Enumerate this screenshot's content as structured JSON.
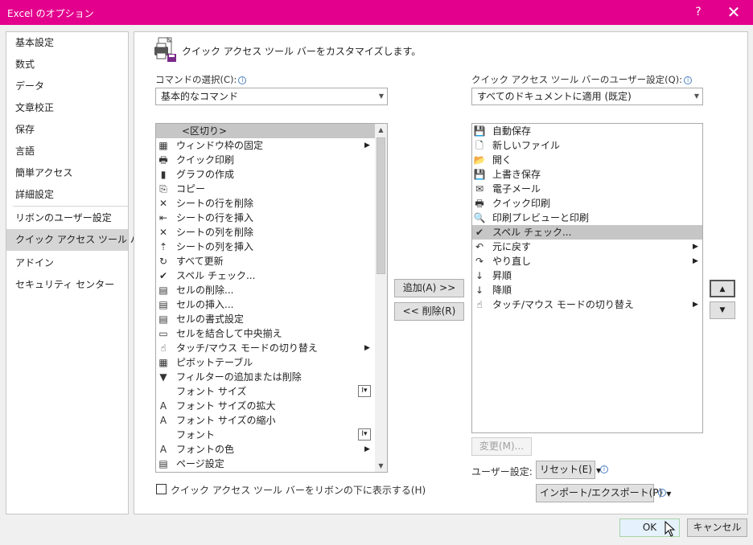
{
  "window": {
    "title": "Excel のオプション",
    "help": "?",
    "close": "✕"
  },
  "sidebar": {
    "items": [
      {
        "label": "基本設定"
      },
      {
        "label": "数式"
      },
      {
        "label": "データ"
      },
      {
        "label": "文章校正"
      },
      {
        "label": "保存"
      },
      {
        "label": "言語"
      },
      {
        "label": "簡単アクセス"
      },
      {
        "label": "詳細設定"
      },
      {
        "label": "リボンのユーザー設定"
      },
      {
        "label": "クイック アクセス ツール バー",
        "selected": true
      },
      {
        "label": "アドイン"
      },
      {
        "label": "セキュリティ センター"
      }
    ]
  },
  "header": {
    "title": "クイック アクセス ツール バーをカスタマイズします。"
  },
  "left": {
    "label": "コマンドの選択(C):",
    "combo": "基本的なコマンド",
    "items": [
      {
        "label": "<区切り>",
        "icon": "",
        "selected": true
      },
      {
        "label": "ウィンドウ枠の固定",
        "icon": "▦",
        "submenu": true
      },
      {
        "label": "クイック印刷",
        "icon": "🖶"
      },
      {
        "label": "グラフの作成",
        "icon": "▮"
      },
      {
        "label": "コピー",
        "icon": "⎘"
      },
      {
        "label": "シートの行を削除",
        "icon": "✕"
      },
      {
        "label": "シートの行を挿入",
        "icon": "⇤"
      },
      {
        "label": "シートの列を削除",
        "icon": "✕"
      },
      {
        "label": "シートの列を挿入",
        "icon": "⇡"
      },
      {
        "label": "すべて更新",
        "icon": "↻"
      },
      {
        "label": "スペル チェック...",
        "icon": "✔"
      },
      {
        "label": "セルの削除...",
        "icon": "▤"
      },
      {
        "label": "セルの挿入...",
        "icon": "▤"
      },
      {
        "label": "セルの書式設定",
        "icon": "▤"
      },
      {
        "label": "セルを結合して中央揃え",
        "icon": "▭"
      },
      {
        "label": "タッチ/マウス モードの切り替え",
        "icon": "☝",
        "submenu": true
      },
      {
        "label": "ピボットテーブル",
        "icon": "▦"
      },
      {
        "label": "フィルターの追加または削除",
        "icon": "▼"
      },
      {
        "label": "フォント サイズ",
        "icon": "",
        "fieldbox": "I▾"
      },
      {
        "label": "フォント サイズの拡大",
        "icon": "A"
      },
      {
        "label": "フォント サイズの縮小",
        "icon": "A"
      },
      {
        "label": "フォント",
        "icon": "",
        "fieldbox": "I▾"
      },
      {
        "label": "フォントの色",
        "icon": "A",
        "submenu": true
      },
      {
        "label": "ページ設定",
        "icon": "▤"
      }
    ]
  },
  "right": {
    "label": "クイック アクセス ツール バーのユーザー設定(Q):",
    "combo": "すべてのドキュメントに適用 (既定)",
    "items": [
      {
        "label": "自動保存",
        "icon": "💾"
      },
      {
        "label": "新しいファイル",
        "icon": "🗋"
      },
      {
        "label": "開く",
        "icon": "📂"
      },
      {
        "label": "上書き保存",
        "icon": "💾"
      },
      {
        "label": "電子メール",
        "icon": "✉"
      },
      {
        "label": "クイック印刷",
        "icon": "🖶"
      },
      {
        "label": "印刷プレビューと印刷",
        "icon": "🔍"
      },
      {
        "label": "スペル チェック...",
        "icon": "✔",
        "selected": true
      },
      {
        "label": "元に戻す",
        "icon": "↶",
        "submenu": true
      },
      {
        "label": "やり直し",
        "icon": "↷",
        "submenu": true
      },
      {
        "label": "昇順",
        "icon": "↓"
      },
      {
        "label": "降順",
        "icon": "↓"
      },
      {
        "label": "タッチ/マウス モードの切り替え",
        "icon": "☝",
        "submenu": true
      }
    ]
  },
  "buttons": {
    "add": "追加(A) >>",
    "remove": "<< 削除(R)",
    "modify": "変更(M)...",
    "user_settings_label": "ユーザー設定:",
    "reset": "リセット(E)",
    "import_export": "インポート/エクスポート(P)",
    "ok": "OK",
    "cancel": "キャンセル",
    "move_up": "▲",
    "move_down": "▼"
  },
  "checkbox": {
    "label": "クイック アクセス ツール バーをリボンの下に表示する(H)",
    "checked": false
  },
  "colors": {
    "titlebar": "#e3008c",
    "selection": "#c6c6c6"
  }
}
